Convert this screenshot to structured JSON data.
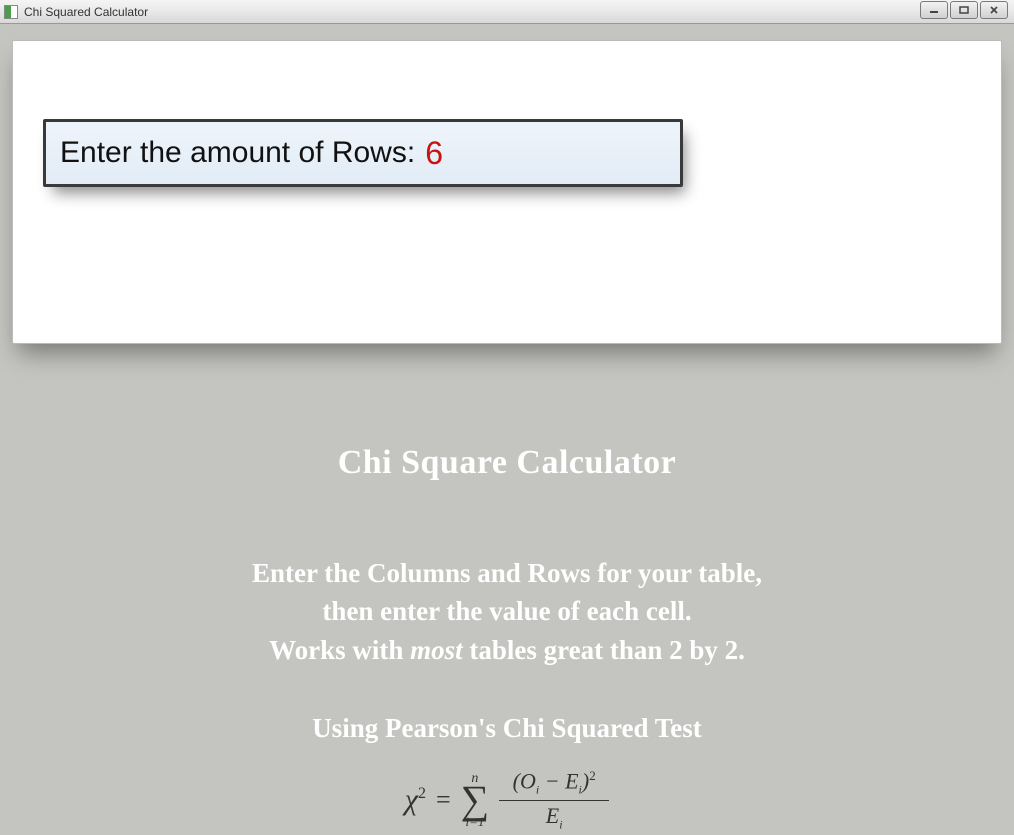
{
  "titlebar": {
    "title": "Chi Squared Calculator"
  },
  "input": {
    "label": "Enter the amount of Rows:",
    "value": "6"
  },
  "heading": "Chi Square Calculator",
  "instructions": {
    "line1": "Enter the Columns and Rows for your table,",
    "line2": "then enter the value of each cell.",
    "line3_prefix": "Works with ",
    "line3_em": "most",
    "line3_suffix": " tables great than 2 by 2."
  },
  "pearson": "Using Pearson's Chi Squared Test",
  "formula": {
    "chi": "χ",
    "exp": "2",
    "eq": "=",
    "sum_top": "n",
    "sum_sigma": "∑",
    "sum_bottom": "i=1",
    "num_left": "(O",
    "num_sub1": "i",
    "num_mid": " − E",
    "num_sub2": "i",
    "num_right": ")",
    "num_exp": "2",
    "den_left": "E",
    "den_sub": "i"
  }
}
